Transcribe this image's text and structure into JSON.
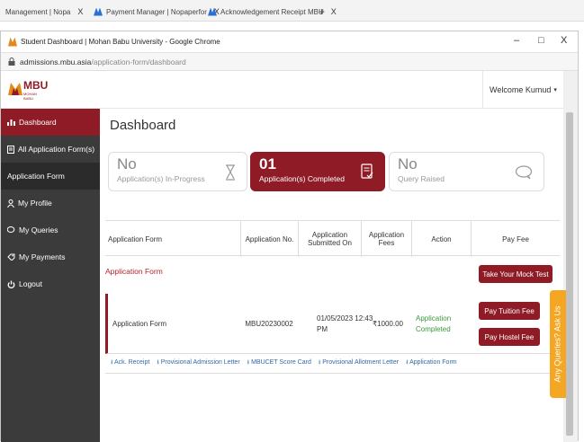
{
  "outer_tabs": [
    {
      "label": "Management | Nopa",
      "close": "X"
    },
    {
      "label": "Payment Manager | Nopaperfor",
      "close": "X"
    },
    {
      "label": "Acknowledgement Receipt MBU",
      "close": "X"
    }
  ],
  "outer_new_tab": "+",
  "window": {
    "title": "Student Dashboard | Mohan Babu University - Google Chrome",
    "url_domain": "admissions.mbu.asia",
    "url_path": "/application-form/dashboard",
    "minimize": "–",
    "maximize": "□",
    "close": "X"
  },
  "header": {
    "logo_text": "MBU",
    "logo_sub": "MOHAN BABU",
    "welcome": "Welcome Kumud"
  },
  "sidebar": {
    "items": [
      {
        "label": "Dashboard",
        "icon": "bar-chart-icon"
      },
      {
        "label": "All Application Form(s)",
        "icon": "list-icon"
      },
      {
        "label": "Application Form",
        "icon": ""
      },
      {
        "label": "My Profile",
        "icon": "user-icon"
      },
      {
        "label": "My Queries",
        "icon": "chat-icon"
      },
      {
        "label": "My Payments",
        "icon": "payment-icon"
      },
      {
        "label": "Logout",
        "icon": "power-icon"
      }
    ]
  },
  "main": {
    "title": "Dashboard",
    "cards": [
      {
        "big": "No",
        "sub": "Application(s) In-Progress",
        "icon": "hourglass-icon"
      },
      {
        "big": "01",
        "sub": "Application(s) Completed",
        "icon": "document-check-icon"
      },
      {
        "big": "No",
        "sub": "Query Raised",
        "icon": "speech-bubble-icon"
      }
    ],
    "table": {
      "headers": [
        "Application Form",
        "Application No.",
        "Application Submitted On",
        "Application Fees",
        "Action",
        "Pay Fee"
      ],
      "section_label": "Application Form",
      "mock_test_button": "Take Your Mock Test",
      "row": {
        "form": "Application Form",
        "number": "MBU20230002",
        "submitted": "01/05/2023 12:43 PM",
        "fees": "₹1000.00",
        "action": "Application Completed",
        "pay_tuition": "Pay Tuition Fee",
        "pay_hostel": "Pay Hostel Fee"
      },
      "links": [
        "Ack. Receipt",
        "Provisional Admission Letter",
        "MBUCET Score Card",
        "Provisional Allotment Letter",
        "Application Form"
      ]
    }
  },
  "side_tab": "Any Queries? Ask Us",
  "colors": {
    "brand": "#8e1b25",
    "sidebar": "#3b3b3b",
    "link": "#2f6aa8",
    "accent": "#f5a623",
    "success": "#3a9a3a"
  }
}
